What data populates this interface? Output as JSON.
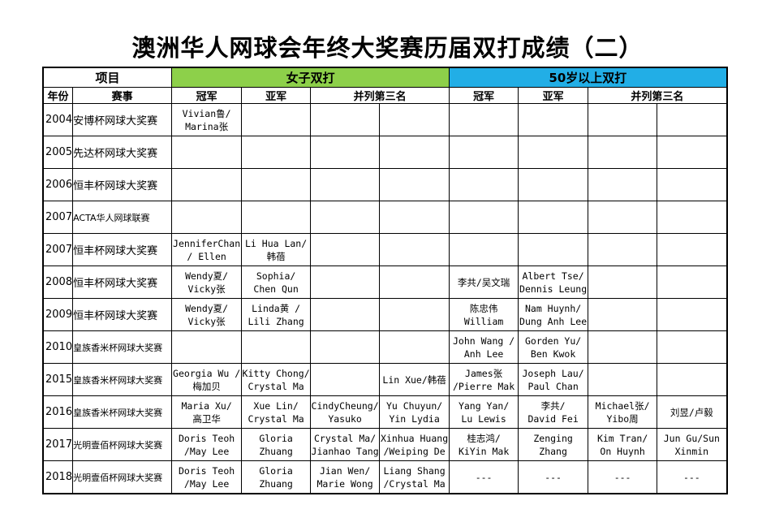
{
  "title": "澳洲华人网球会年终大奖赛历届双打成绩（二）",
  "header": {
    "project": "项目",
    "women": "女子双打",
    "over50": "50岁以上双打",
    "year": "年份",
    "event": "赛事",
    "champion": "冠军",
    "runner_up": "亚军",
    "third": "并列第三名"
  },
  "rows": [
    {
      "year": "2004",
      "event": "安博杯网球大奖赛",
      "w_champ": [
        "Vivian鲁/",
        "Marina张"
      ],
      "w_runner": [],
      "w_third1": [],
      "w_third2": [],
      "s_champ": [],
      "s_runner": [],
      "s_third1": [],
      "s_third2": []
    },
    {
      "year": "2005",
      "event": "先达杯网球大奖赛",
      "w_champ": [],
      "w_runner": [],
      "w_third1": [],
      "w_third2": [],
      "s_champ": [],
      "s_runner": [],
      "s_third1": [],
      "s_third2": []
    },
    {
      "year": "2006",
      "event": "恒丰杯网球大奖赛",
      "w_champ": [],
      "w_runner": [],
      "w_third1": [],
      "w_third2": [],
      "s_champ": [],
      "s_runner": [],
      "s_third1": [],
      "s_third2": []
    },
    {
      "year": "2007",
      "event": "ACTA华人网球联赛",
      "w_champ": [],
      "w_runner": [],
      "w_third1": [],
      "w_third2": [],
      "s_champ": [],
      "s_runner": [],
      "s_third1": [],
      "s_third2": []
    },
    {
      "year": "2007",
      "event": "恒丰杯网球大奖赛",
      "w_champ": [
        "JenniferChan",
        "/ Ellen"
      ],
      "w_runner": [
        "Li Hua Lan/",
        "韩蓓"
      ],
      "w_third1": [],
      "w_third2": [],
      "s_champ": [],
      "s_runner": [],
      "s_third1": [],
      "s_third2": []
    },
    {
      "year": "2008",
      "event": "恒丰杯网球大奖赛",
      "w_champ": [
        "Wendy夏/",
        "Vicky张"
      ],
      "w_runner": [
        "Sophia/",
        "Chen Qun"
      ],
      "w_third1": [],
      "w_third2": [],
      "s_champ": [
        "李共/吴文瑞"
      ],
      "s_runner": [
        "Albert Tse/",
        "Dennis Leung"
      ],
      "s_third1": [],
      "s_third2": []
    },
    {
      "year": "2009",
      "event": "恒丰杯网球大奖赛",
      "w_champ": [
        "Wendy夏/",
        "Vicky张"
      ],
      "w_runner": [
        "Linda黄 /",
        "Lili Zhang"
      ],
      "w_third1": [],
      "w_third2": [],
      "s_champ": [
        "陈忠伟",
        "William"
      ],
      "s_runner": [
        "Nam Huynh/",
        "Dung Anh Lee"
      ],
      "s_third1": [],
      "s_third2": []
    },
    {
      "year": "2010",
      "event": "皇族香米杯网球大奖赛",
      "w_champ": [],
      "w_runner": [],
      "w_third1": [],
      "w_third2": [],
      "s_champ": [
        "John Wang /",
        "Anh Lee"
      ],
      "s_runner": [
        "Gorden Yu/",
        "Ben Kwok"
      ],
      "s_third1": [],
      "s_third2": []
    },
    {
      "year": "2015",
      "event": "皇族香米杯网球大奖赛",
      "w_champ": [
        "Georgia Wu /",
        "梅加贝"
      ],
      "w_runner": [
        "Kitty Chong/",
        "Crystal Ma"
      ],
      "w_third1": [],
      "w_third2": [
        "Lin Xue/韩蓓"
      ],
      "s_champ": [
        "James张",
        "/Pierre Mak"
      ],
      "s_runner": [
        "Joseph Lau/",
        "Paul Chan"
      ],
      "s_third1": [],
      "s_third2": []
    },
    {
      "year": "2016",
      "event": "皇族香米杯网球大奖赛",
      "w_champ": [
        "Maria Xu/",
        "高卫华"
      ],
      "w_runner": [
        "Xue Lin/",
        "Crystal Ma"
      ],
      "w_third1": [
        "CindyCheung/",
        "Yasuko"
      ],
      "w_third2": [
        "Yu Chuyun/",
        "Yin Lydia"
      ],
      "s_champ": [
        "Yang Yan/",
        "Lu Lewis"
      ],
      "s_runner": [
        "李共/",
        "David Fei"
      ],
      "s_third1": [
        "Michael张/",
        "Yibo周"
      ],
      "s_third2": [
        "刘昱/卢毅"
      ]
    },
    {
      "year": "2017",
      "event": "光明壹佰杯网球大奖赛",
      "w_champ": [
        "Doris Teoh",
        "/May Lee"
      ],
      "w_runner": [
        "Gloria",
        "Zhuang"
      ],
      "w_third1": [
        "Crystal Ma/",
        "Jianhao Tang"
      ],
      "w_third2": [
        "Xinhua Huang",
        "/Weiping De"
      ],
      "s_champ": [
        "桂志鸿/",
        "KiYin Mak"
      ],
      "s_runner": [
        "Zenging",
        "Zhang"
      ],
      "s_third1": [
        "Kim Tran/",
        "On Huynh"
      ],
      "s_third2": [
        "Jun Gu/Sun",
        "Xinmin"
      ]
    },
    {
      "year": "2018",
      "event": "光明壹佰杯网球大奖赛",
      "w_champ": [
        "Doris Teoh",
        "/May Lee"
      ],
      "w_runner": [
        "Gloria",
        "Zhuang"
      ],
      "w_third1": [
        "Jian Wen/",
        "Marie Wong"
      ],
      "w_third2": [
        "Liang Shang",
        "/Crystal Ma"
      ],
      "s_champ": [
        "---"
      ],
      "s_runner": [
        "---"
      ],
      "s_third1": [
        "---"
      ],
      "s_third2": [
        "---"
      ]
    }
  ]
}
